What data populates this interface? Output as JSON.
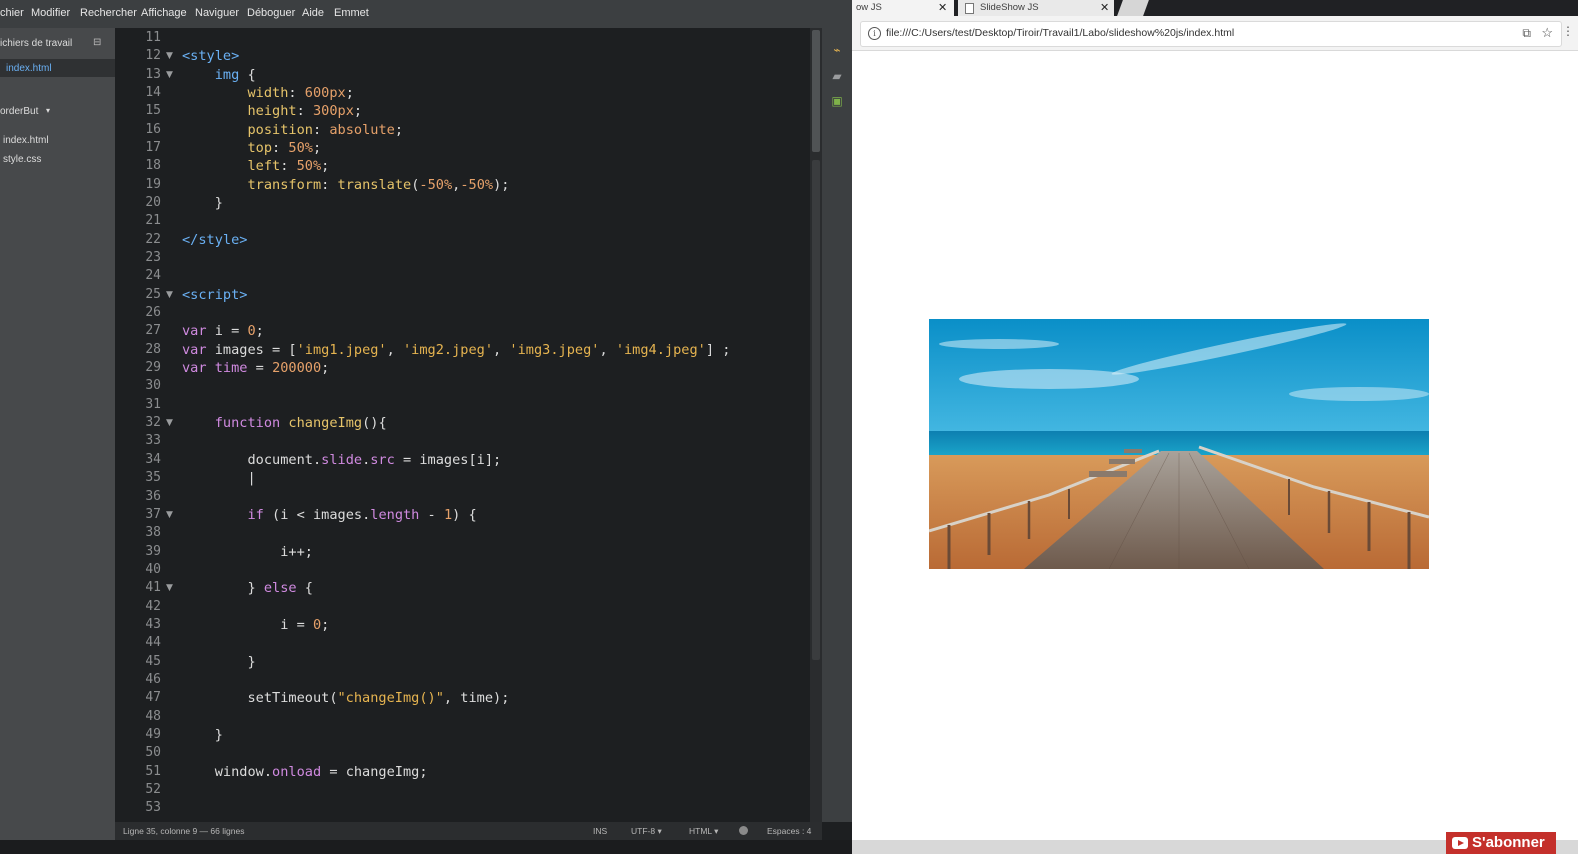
{
  "menubar": {
    "items": [
      "chier",
      "Modifier",
      "Rechercher",
      "Affichage",
      "Naviguer",
      "Déboguer",
      "Aide",
      "Emmet"
    ]
  },
  "sidebar": {
    "working_files_label": "ichiers de travail",
    "working_file": "index.html",
    "project_label": "orderBut",
    "project_caret": "▾",
    "files": [
      "index.html",
      "style.css"
    ]
  },
  "editor": {
    "code_lines": [
      {
        "n": "11",
        "fold": false,
        "html": ""
      },
      {
        "n": "12",
        "fold": true,
        "html": "<span class='tg'>&lt;style&gt;</span>"
      },
      {
        "n": "13",
        "fold": true,
        "html": "    <span class='tg'>img</span> {"
      },
      {
        "n": "14",
        "fold": false,
        "html": "        <span class='pr'>width</span>: <span class='nm'>600px</span>;"
      },
      {
        "n": "15",
        "fold": false,
        "html": "        <span class='pr'>height</span>: <span class='nm'>300px</span>;"
      },
      {
        "n": "16",
        "fold": false,
        "html": "        <span class='pr'>position</span>: <span class='nm'>absolute</span>;"
      },
      {
        "n": "17",
        "fold": false,
        "html": "        <span class='pr'>top</span>: <span class='nm'>50%</span>;"
      },
      {
        "n": "18",
        "fold": false,
        "html": "        <span class='pr'>left</span>: <span class='nm'>50%</span>;"
      },
      {
        "n": "19",
        "fold": false,
        "html": "        <span class='pr'>transform</span>: <span class='fn'>translate</span>(<span class='nm'>-50%</span>,<span class='nm'>-50%</span>);"
      },
      {
        "n": "20",
        "fold": false,
        "html": "    }"
      },
      {
        "n": "21",
        "fold": false,
        "html": ""
      },
      {
        "n": "22",
        "fold": false,
        "html": "<span class='tg'>&lt;/style&gt;</span>"
      },
      {
        "n": "23",
        "fold": false,
        "html": ""
      },
      {
        "n": "24",
        "fold": false,
        "html": ""
      },
      {
        "n": "25",
        "fold": true,
        "html": "<span class='tg'>&lt;script&gt;</span>"
      },
      {
        "n": "26",
        "fold": false,
        "html": ""
      },
      {
        "n": "27",
        "fold": false,
        "html": "<span class='kw'>var</span> i = <span class='nm'>0</span>;"
      },
      {
        "n": "28",
        "fold": false,
        "html": "<span class='kw'>var</span> images = [<span class='st'>'img1.jpeg'</span>, <span class='st'>'img2.jpeg'</span>, <span class='st'>'img3.jpeg'</span>, <span class='st'>'img4.jpeg'</span>] ;"
      },
      {
        "n": "29",
        "fold": false,
        "html": "<span class='kw'>var</span> <span class='kw'>time</span> = <span class='nm'>200000</span>;"
      },
      {
        "n": "30",
        "fold": false,
        "html": ""
      },
      {
        "n": "31",
        "fold": false,
        "html": ""
      },
      {
        "n": "32",
        "fold": true,
        "html": "    <span class='kw'>function</span> <span class='fn'>changeImg</span>(){"
      },
      {
        "n": "33",
        "fold": false,
        "html": ""
      },
      {
        "n": "34",
        "fold": false,
        "html": "        document.<span class='kw'>slide</span>.<span class='kw'>src</span> = images[i];"
      },
      {
        "n": "35",
        "fold": false,
        "html": "        |"
      },
      {
        "n": "36",
        "fold": false,
        "html": ""
      },
      {
        "n": "37",
        "fold": true,
        "html": "        <span class='kw'>if</span> (i &lt; images.<span class='kw'>length</span> - <span class='nm'>1</span>) {"
      },
      {
        "n": "38",
        "fold": false,
        "html": ""
      },
      {
        "n": "39",
        "fold": false,
        "html": "            i++;"
      },
      {
        "n": "40",
        "fold": false,
        "html": ""
      },
      {
        "n": "41",
        "fold": true,
        "html": "        } <span class='kw'>else</span> {"
      },
      {
        "n": "42",
        "fold": false,
        "html": ""
      },
      {
        "n": "43",
        "fold": false,
        "html": "            i = <span class='nm'>0</span>;"
      },
      {
        "n": "44",
        "fold": false,
        "html": ""
      },
      {
        "n": "45",
        "fold": false,
        "html": "        }"
      },
      {
        "n": "46",
        "fold": false,
        "html": ""
      },
      {
        "n": "47",
        "fold": false,
        "html": "        setTimeout(<span class='st'>\"changeImg()\"</span>, time);"
      },
      {
        "n": "48",
        "fold": false,
        "html": ""
      },
      {
        "n": "49",
        "fold": false,
        "html": "    }"
      },
      {
        "n": "50",
        "fold": false,
        "html": ""
      },
      {
        "n": "51",
        "fold": false,
        "html": "    window.<span class='kw'>onload</span> = changeImg;"
      },
      {
        "n": "52",
        "fold": false,
        "html": ""
      },
      {
        "n": "53",
        "fold": false,
        "html": ""
      }
    ]
  },
  "statusbar": {
    "position": "Ligne 35, colonne 9 — 66 lignes",
    "mode": "INS",
    "encoding": "UTF-8 ▾",
    "language": "HTML ▾",
    "indent": "Espaces : 4"
  },
  "browser": {
    "tabs": [
      {
        "title": "ow JS",
        "close": "✕"
      },
      {
        "title": "SlideShow JS",
        "close": "✕"
      }
    ],
    "url": "file:///C:/Users/test/Desktop/Tiroir/Travail1/Labo/slideshow%20js/index.html"
  },
  "overlay": {
    "subscribe_label": "S'abonner"
  },
  "colors": {
    "editor_bg": "#1d1f21",
    "tag": "#6ab0f3",
    "keyword": "#d08ae0",
    "property": "#e6c46a",
    "number": "#e6a16a",
    "string": "#e6b450",
    "subscribe": "#c4302b"
  }
}
